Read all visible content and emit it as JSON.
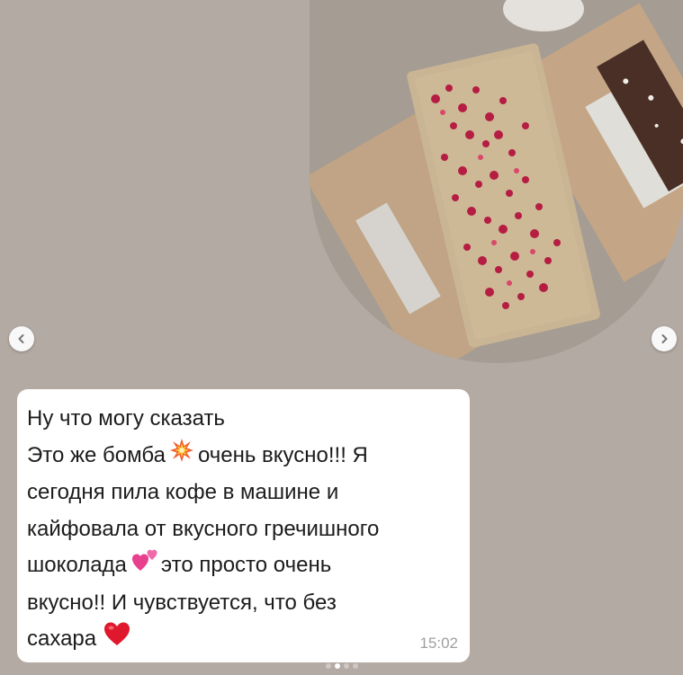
{
  "post": {
    "image": {
      "description_icon": "chocolate-bar-photo"
    },
    "carousel": {
      "prev_icon": "chevron-left-icon",
      "next_icon": "chevron-right-icon",
      "slide_count": 4,
      "active_index": 1
    },
    "message": {
      "lines": [
        "Ну что могу сказать",
        "Это же бомба",
        "очень вкусно!!! Я",
        "сегодня пила кофе в машине и",
        "кайфовала от вкусного гречишного",
        "шоколада",
        "это просто очень",
        "вкусно!! И чувствуется, что без",
        "сахара"
      ],
      "emojis": [
        "collision-icon",
        "two-hearts-icon",
        "red-heart-icon"
      ],
      "time": "15:02"
    },
    "colors": {
      "background": "#b4aaa4",
      "bubble": "#ffffff",
      "timestamp": "#a0a0a0",
      "heart": "#e0182d",
      "pink_hearts": "#ec3c8c"
    }
  }
}
